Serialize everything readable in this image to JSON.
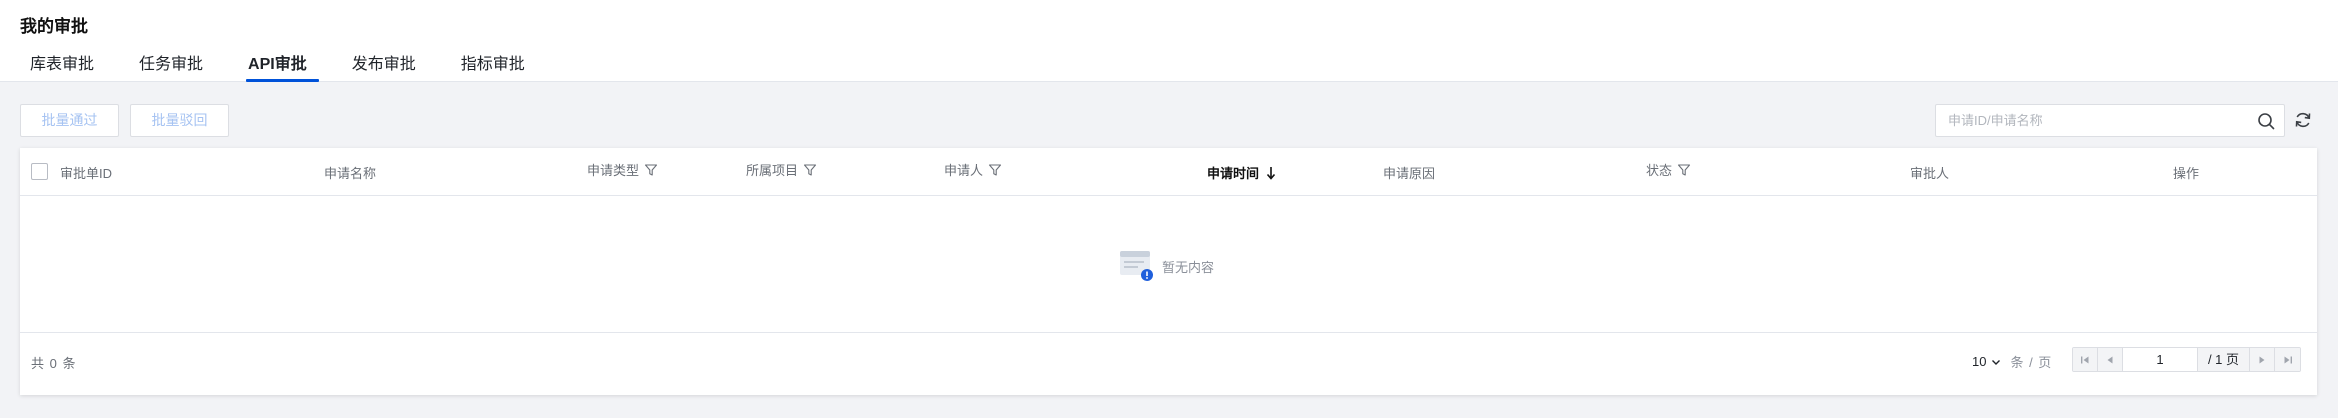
{
  "page": {
    "title": "我的审批"
  },
  "tabs": [
    {
      "label": "库表审批"
    },
    {
      "label": "任务审批"
    },
    {
      "label": "API审批",
      "active": true
    },
    {
      "label": "发布审批"
    },
    {
      "label": "指标审批"
    }
  ],
  "toolbar": {
    "batch_approve_label": "批量通过",
    "batch_reject_label": "批量驳回",
    "search_placeholder": "申请ID/申请名称"
  },
  "table": {
    "columns": [
      {
        "label": "审批单ID"
      },
      {
        "label": "申请名称"
      },
      {
        "label": "申请类型",
        "filter": true
      },
      {
        "label": "所属项目",
        "filter": true
      },
      {
        "label": "申请人",
        "filter": true
      },
      {
        "label": "申请时间",
        "sorted": "desc"
      },
      {
        "label": "申请原因"
      },
      {
        "label": "状态",
        "filter": true
      },
      {
        "label": "审批人"
      },
      {
        "label": "操作"
      }
    ],
    "empty_text": "暂无内容"
  },
  "pagination": {
    "total_text": "共 0 条",
    "page_size": "10",
    "per_page_label": "条 / 页",
    "current_page": "1",
    "total_pages_text": "/ 1 页"
  },
  "colors": {
    "accent": "#0052d9",
    "disabled_text": "#a6c3f2"
  }
}
